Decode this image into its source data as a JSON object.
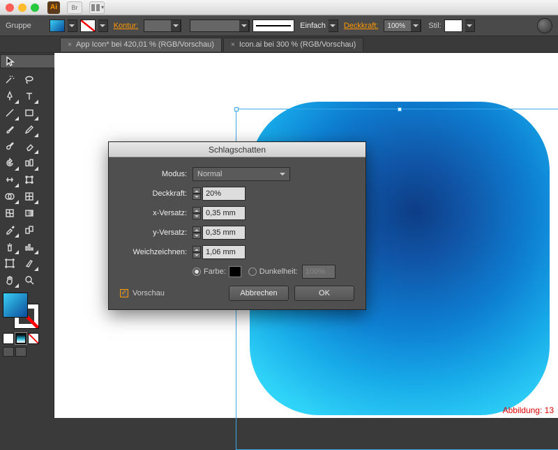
{
  "app": {
    "short": "Ai",
    "bridge": "Br"
  },
  "optbar": {
    "group": "Gruppe",
    "kontur": "Kontur:",
    "einfach": "Einfach",
    "deckkraft": "Deckkraft:",
    "deckkraft_val": "100%",
    "stil": "Stil:"
  },
  "tabs": [
    "App Icon* bei 420,01 % (RGB/Vorschau)",
    "Icon.ai bei 300 % (RGB/Vorschau)"
  ],
  "dialog": {
    "title": "Schlagschatten",
    "modus": "Modus:",
    "modus_val": "Normal",
    "deckkraft": "Deckkraft:",
    "deckkraft_val": "20%",
    "xv": "x-Versatz:",
    "xv_val": "0,35 mm",
    "yv": "y-Versatz:",
    "yv_val": "0,35 mm",
    "weich": "Weichzeichnen:",
    "weich_val": "1,06 mm",
    "farbe": "Farbe:",
    "dunkel": "Dunkelheit:",
    "dunkel_val": "100%",
    "vorschau": "Vorschau",
    "cancel": "Abbrechen",
    "ok": "OK"
  },
  "figure": "Abbildung: 13"
}
